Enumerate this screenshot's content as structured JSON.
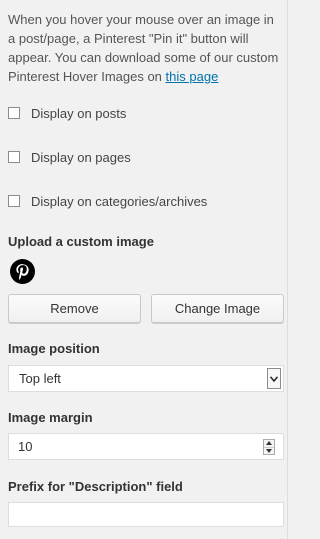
{
  "intro": {
    "text": "When you hover your mouse over an image in a post/page, a Pinterest \"Pin it\" button will appear. You can download some of our custom Pinterest Hover Images on ",
    "link_text": "this page"
  },
  "checkboxes": [
    {
      "label": "Display on posts",
      "checked": false
    },
    {
      "label": "Display on pages",
      "checked": false
    },
    {
      "label": "Display on categories/archives",
      "checked": false
    }
  ],
  "upload": {
    "title": "Upload a custom image",
    "icon": "pinterest-icon",
    "remove_label": "Remove",
    "change_label": "Change Image"
  },
  "image_position": {
    "title": "Image position",
    "selected": "Top left"
  },
  "image_margin": {
    "title": "Image margin",
    "value": "10"
  },
  "prefix": {
    "title": "Prefix for \"Description\" field",
    "value": ""
  },
  "colors": {
    "link": "#0073aa",
    "pinterest_red": "#000000",
    "background": "#f1f1f1"
  }
}
